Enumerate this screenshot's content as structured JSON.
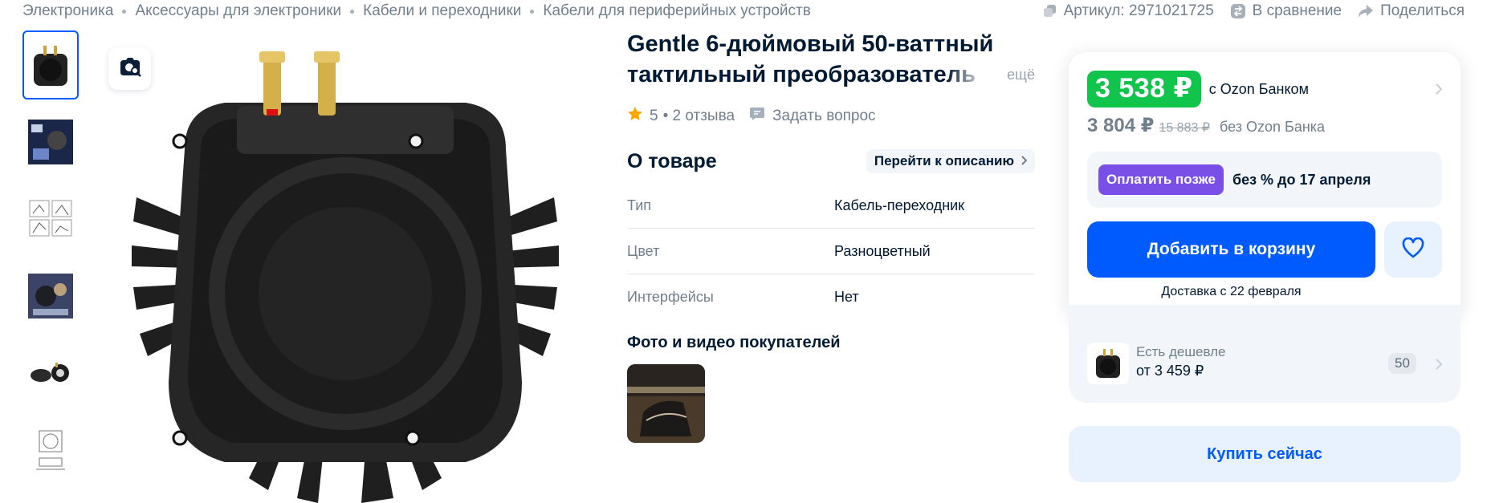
{
  "breadcrumb": [
    "Электроника",
    "Аксессуары для электроники",
    "Кабели и переходники",
    "Кабели для периферийных устройств"
  ],
  "top_actions": {
    "article": "Артикул: 2971021725",
    "compare": "В сравнение",
    "share": "Поделиться"
  },
  "product": {
    "title": "Gentle 6-дюймовый 50-ваттный тактильный преобразователь",
    "more": "ещё",
    "rating": "5",
    "reviews": "• 2 отзыва",
    "ask_question": "Задать вопрос"
  },
  "about": {
    "title": "О товаре",
    "goto": "Перейти к описанию",
    "specs": [
      {
        "key": "Тип",
        "value": "Кабель-переходник"
      },
      {
        "key": "Цвет",
        "value": "Разноцветный"
      },
      {
        "key": "Интерфейсы",
        "value": "Нет"
      }
    ]
  },
  "customer_photos": {
    "title": "Фото и видео покупателей"
  },
  "price": {
    "bank_price": "3 538 ₽",
    "bank_label": "с Ozon Банком",
    "regular_price": "3 804 ₽",
    "old_price": "15 883 ₽",
    "regular_label": "без Ozon Банка",
    "pay_later_button": "Оплатить позже",
    "pay_later_text": "без % до 17 апреля",
    "add_to_cart": "Добавить в корзину",
    "delivery": "Доставка с 22 февраля"
  },
  "cheaper": {
    "label": "Есть дешевле",
    "price": "от 3 459 ₽",
    "count": "50"
  },
  "buy_now": "Купить сейчас",
  "icons": {
    "compare": "compare-icon",
    "share": "share-icon",
    "article": "copy-icon",
    "star": "star-icon",
    "ask": "chat-icon",
    "heart": "heart-icon",
    "photo_search": "photo-search-icon"
  },
  "colors": {
    "accent": "#005bff",
    "price_green": "#10c44c",
    "pay_later": "#7a4fe8",
    "star": "#ffa800"
  }
}
